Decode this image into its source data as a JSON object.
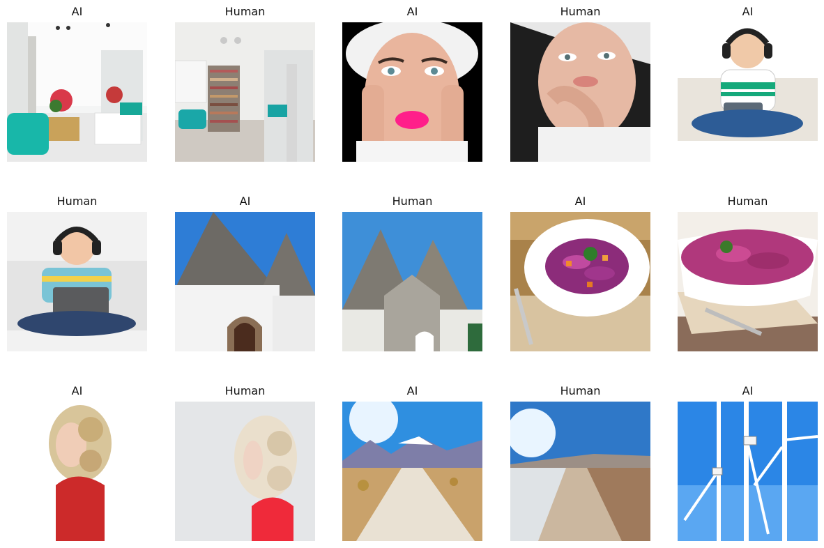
{
  "grid": {
    "items": [
      {
        "label": "AI",
        "scene": "living-room",
        "variant": "ai"
      },
      {
        "label": "Human",
        "scene": "living-room",
        "variant": "human"
      },
      {
        "label": "AI",
        "scene": "woman-face",
        "variant": "ai"
      },
      {
        "label": "Human",
        "scene": "woman-face",
        "variant": "human"
      },
      {
        "label": "AI",
        "scene": "boy-tablet",
        "variant": "ai"
      },
      {
        "label": "Human",
        "scene": "boy-tablet",
        "variant": "human"
      },
      {
        "label": "AI",
        "scene": "trulli",
        "variant": "ai"
      },
      {
        "label": "Human",
        "scene": "trulli",
        "variant": "human"
      },
      {
        "label": "AI",
        "scene": "cabbage-salad",
        "variant": "ai"
      },
      {
        "label": "Human",
        "scene": "cabbage-salad",
        "variant": "human"
      },
      {
        "label": "AI",
        "scene": "curly-woman",
        "variant": "ai"
      },
      {
        "label": "Human",
        "scene": "curly-woman",
        "variant": "human"
      },
      {
        "label": "AI",
        "scene": "desert-road",
        "variant": "ai"
      },
      {
        "label": "Human",
        "scene": "desert-road",
        "variant": "human"
      },
      {
        "label": "AI",
        "scene": "wind-turbines",
        "variant": "ai"
      }
    ]
  }
}
